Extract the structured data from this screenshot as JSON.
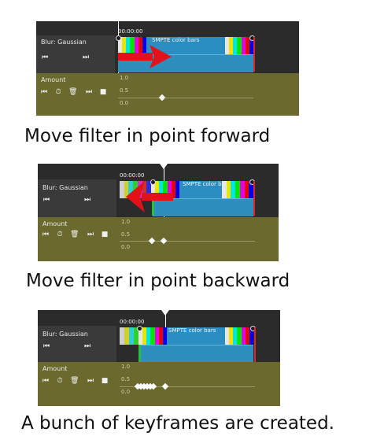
{
  "panels": [
    {
      "filter_name": "Blur: Gaussian",
      "param_name": "Amount",
      "timecode": "00:00:00",
      "clip_title": "SMPTE color bars",
      "scale": [
        "1.0",
        "0.5",
        "0.0"
      ],
      "arrow": "right",
      "caption": "Move filter in point forward"
    },
    {
      "filter_name": "Blur: Gaussian",
      "param_name": "Amount",
      "timecode": "00:00:00",
      "clip_title": "SMPTE color bars",
      "scale": [
        "1.0",
        "0.5",
        "0.0"
      ],
      "arrow": "left",
      "caption": "Move filter in point backward"
    },
    {
      "filter_name": "Blur: Gaussian",
      "param_name": "Amount",
      "timecode": "00:00:00",
      "clip_title": "SMPTE color bars",
      "scale": [
        "1.0",
        "0.5",
        "0.0"
      ],
      "arrow": "none",
      "caption": "A bunch of keyframes are created."
    }
  ],
  "icons": {
    "seek_start": "⏮",
    "seek_end": "⏭",
    "keyframe_prev": "⏮",
    "stopwatch": "⏱",
    "trash": "🗑",
    "keyframe_next": "⏭",
    "stop": "■"
  },
  "colors": {
    "clip_blue": "#2c8dc1",
    "keyframe_track": "#6b6a2e",
    "marker_red": "#e0242a",
    "arrow_red": "#e3121a",
    "filter_in_green": "#26c23a"
  }
}
